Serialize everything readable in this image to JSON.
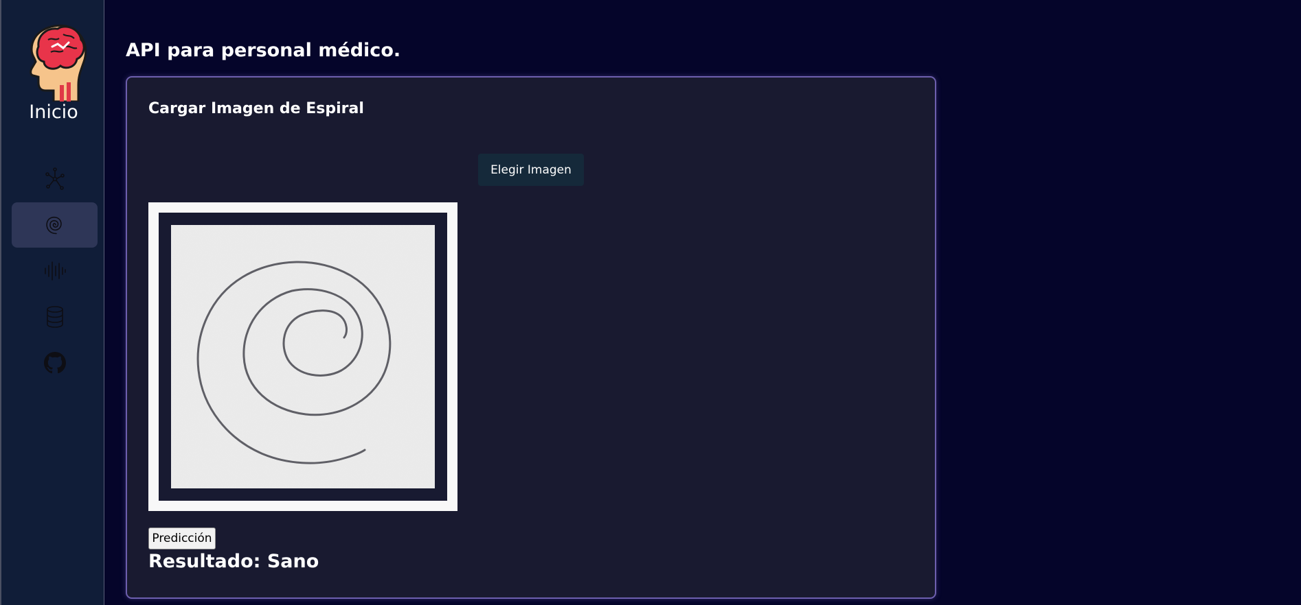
{
  "sidebar": {
    "brand_label": "Inicio",
    "brand_icon": "brain-head-icon",
    "items": [
      {
        "icon": "network-nodes-icon",
        "active": false
      },
      {
        "icon": "spiral-icon",
        "active": true
      },
      {
        "icon": "waveform-icon",
        "active": false
      },
      {
        "icon": "database-icon",
        "active": false
      },
      {
        "icon": "github-icon",
        "active": false
      }
    ]
  },
  "page": {
    "title": "API para personal médico."
  },
  "card": {
    "title": "Cargar Imagen de Espiral",
    "choose_button": "Elegir Imagen",
    "predict_button": "Predicción",
    "result": "Resultado: Sano"
  },
  "colors": {
    "background": "#05052a",
    "sidebar": "#101d38",
    "card": "#191a30",
    "card_border": "#6d5fae",
    "active_nav": "#2e3657"
  }
}
